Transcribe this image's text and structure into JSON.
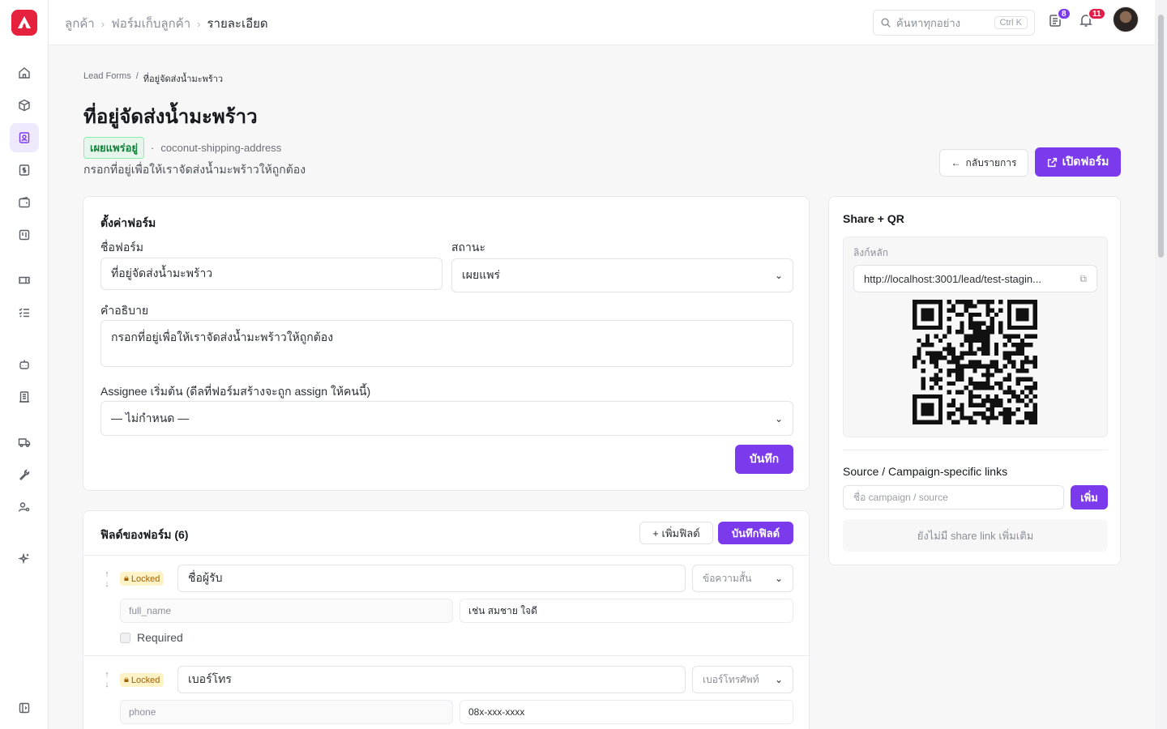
{
  "topbar": {
    "crumbs": [
      "ลูกค้า",
      "ฟอร์มเก็บลูกค้า",
      "รายละเอียด"
    ],
    "search_placeholder": "ค้นหาทุกอย่าง",
    "search_shortcut": "Ctrl K",
    "tasks_badge": "8",
    "notif_badge": "11"
  },
  "page": {
    "breadcrumb_root": "Lead Forms",
    "breadcrumb_sep": "/",
    "breadcrumb_current": "ที่อยู่จัดส่งน้ำมะพร้าว",
    "title": "ที่อยู่จัดส่งน้ำมะพร้าว",
    "status_pill": "เผยแพร่อยู่",
    "dot": "·",
    "slug": "coconut-shipping-address",
    "description": "กรอกที่อยู่เพื่อให้เราจัดส่งน้ำมะพร้าวให้ถูกต้อง",
    "back_label": "กลับรายการ",
    "open_label": "เปิดฟอร์ม"
  },
  "settings": {
    "title": "ตั้งค่าฟอร์ม",
    "name_label": "ชื่อฟอร์ม",
    "name_value": "ที่อยู่จัดส่งน้ำมะพร้าว",
    "status_label": "สถานะ",
    "status_value": "เผยแพร่",
    "desc_label": "คำอธิบาย",
    "desc_value": "กรอกที่อยู่เพื่อให้เราจัดส่งน้ำมะพร้าวให้ถูกต้อง",
    "assignee_label": "Assignee เริ่มต้น (ดีลที่ฟอร์มสร้างจะถูก assign ให้คนนี้)",
    "assignee_value": "— ไม่กำหนด —",
    "save_label": "บันทึก"
  },
  "fields": {
    "title": "ฟิลด์ของฟอร์ม (6)",
    "add_label": "+ เพิ่มฟิลด์",
    "save_label": "บันทึกฟิลด์",
    "locked_label": "Locked",
    "items": [
      {
        "label": "ชื่อผู้รับ",
        "type": "ข้อความสั้น",
        "key": "full_name",
        "placeholder": "เช่น สมชาย ใจดี",
        "required": "Required"
      },
      {
        "label": "เบอร์โทร",
        "type": "เบอร์โทรศัพท์",
        "key": "phone",
        "placeholder": "08x-xxx-xxxx"
      }
    ]
  },
  "share": {
    "title": "Share + QR",
    "main_link_label": "ลิงก์หลัก",
    "main_link": "http://localhost:3001/lead/test-stagin...",
    "campaign_title": "Source / Campaign-specific links",
    "campaign_placeholder": "ชื่อ campaign / source",
    "add_label": "เพิ่ม",
    "empty": "ยังไม่มี share link เพิ่มเติม"
  },
  "colors": {
    "accent": "#7c3aed",
    "logo": "#e5213e",
    "published": "#15803d"
  }
}
